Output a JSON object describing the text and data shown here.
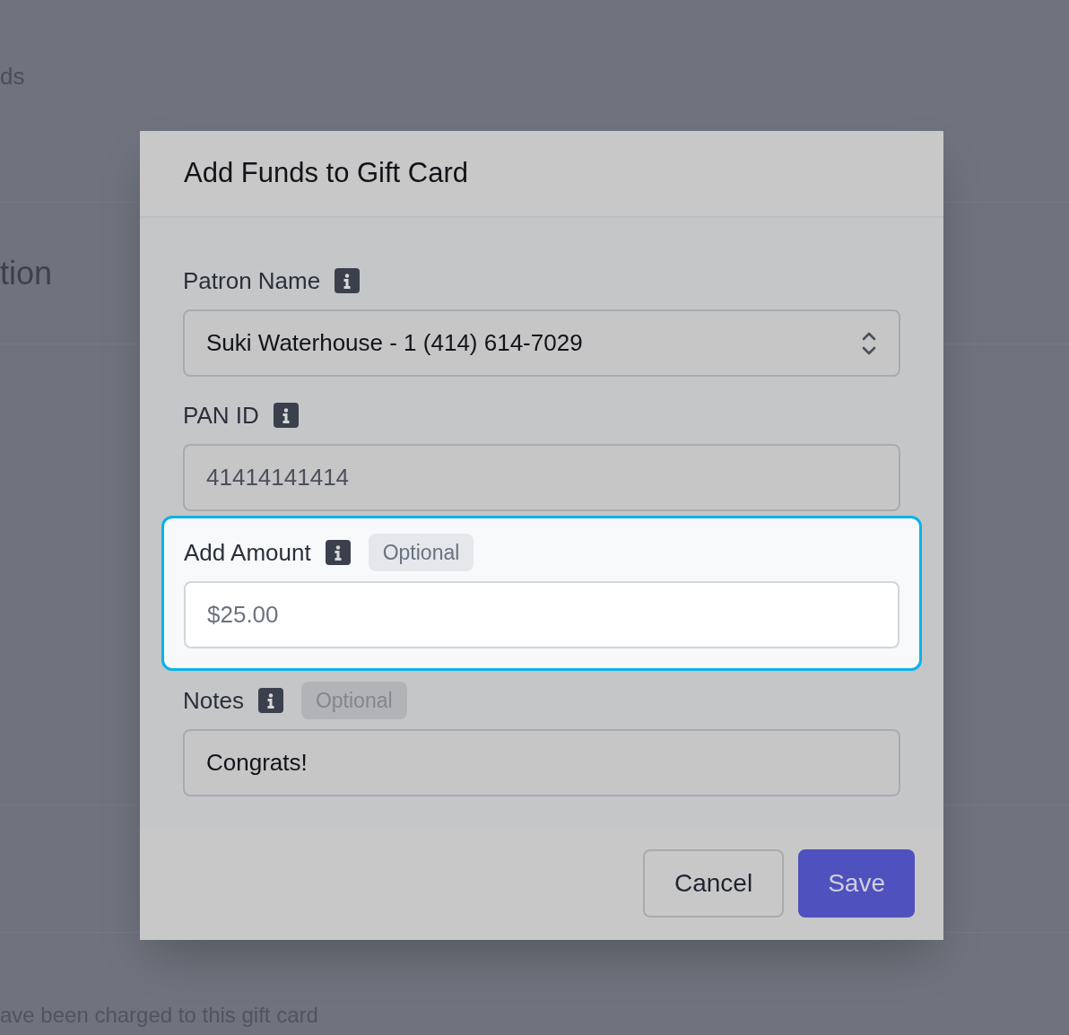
{
  "background": {
    "heading_fragment": "ds",
    "section_fragment": "tion",
    "footer_fragment": "ave been charged to this gift card"
  },
  "dialog": {
    "title": "Add Funds to Gift Card",
    "fields": [
      {
        "kind": "select",
        "label": "Patron Name",
        "value": "Suki Waterhouse - 1 (414) 614-7029",
        "highlighted": false
      },
      {
        "kind": "readonly",
        "label": "PAN ID",
        "value": "41414141414",
        "highlighted": false
      },
      {
        "kind": "input",
        "label": "Add Amount",
        "badge": "Optional",
        "placeholder": "$25.00",
        "highlighted": true
      },
      {
        "kind": "input",
        "label": "Notes",
        "badge": "Optional",
        "value": "Congrats!",
        "highlighted": false
      }
    ],
    "buttons": [
      {
        "kind": "secondary",
        "label": "Cancel"
      },
      {
        "kind": "primary",
        "label": "Save"
      }
    ]
  }
}
